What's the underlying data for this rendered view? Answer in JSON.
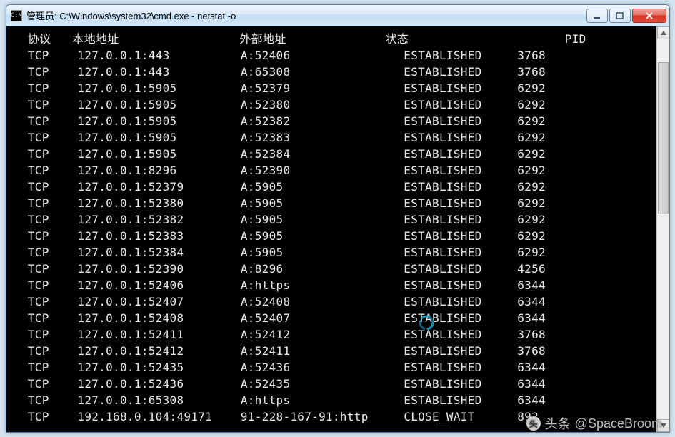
{
  "window": {
    "icon_text": "C:\\",
    "title": "管理员: C:\\Windows\\system32\\cmd.exe - netstat  -o"
  },
  "headers": {
    "proto": "协议",
    "local": "本地地址",
    "foreign": "外部地址",
    "state": "状态",
    "pid": "PID"
  },
  "rows": [
    {
      "proto": "TCP",
      "local": "127.0.0.1:443",
      "foreign": "A:52406",
      "state": "ESTABLISHED",
      "pid": "3768"
    },
    {
      "proto": "TCP",
      "local": "127.0.0.1:443",
      "foreign": "A:65308",
      "state": "ESTABLISHED",
      "pid": "3768"
    },
    {
      "proto": "TCP",
      "local": "127.0.0.1:5905",
      "foreign": "A:52379",
      "state": "ESTABLISHED",
      "pid": "6292"
    },
    {
      "proto": "TCP",
      "local": "127.0.0.1:5905",
      "foreign": "A:52380",
      "state": "ESTABLISHED",
      "pid": "6292"
    },
    {
      "proto": "TCP",
      "local": "127.0.0.1:5905",
      "foreign": "A:52382",
      "state": "ESTABLISHED",
      "pid": "6292"
    },
    {
      "proto": "TCP",
      "local": "127.0.0.1:5905",
      "foreign": "A:52383",
      "state": "ESTABLISHED",
      "pid": "6292"
    },
    {
      "proto": "TCP",
      "local": "127.0.0.1:5905",
      "foreign": "A:52384",
      "state": "ESTABLISHED",
      "pid": "6292"
    },
    {
      "proto": "TCP",
      "local": "127.0.0.1:8296",
      "foreign": "A:52390",
      "state": "ESTABLISHED",
      "pid": "6292"
    },
    {
      "proto": "TCP",
      "local": "127.0.0.1:52379",
      "foreign": "A:5905",
      "state": "ESTABLISHED",
      "pid": "6292"
    },
    {
      "proto": "TCP",
      "local": "127.0.0.1:52380",
      "foreign": "A:5905",
      "state": "ESTABLISHED",
      "pid": "6292"
    },
    {
      "proto": "TCP",
      "local": "127.0.0.1:52382",
      "foreign": "A:5905",
      "state": "ESTABLISHED",
      "pid": "6292"
    },
    {
      "proto": "TCP",
      "local": "127.0.0.1:52383",
      "foreign": "A:5905",
      "state": "ESTABLISHED",
      "pid": "6292"
    },
    {
      "proto": "TCP",
      "local": "127.0.0.1:52384",
      "foreign": "A:5905",
      "state": "ESTABLISHED",
      "pid": "6292"
    },
    {
      "proto": "TCP",
      "local": "127.0.0.1:52390",
      "foreign": "A:8296",
      "state": "ESTABLISHED",
      "pid": "4256"
    },
    {
      "proto": "TCP",
      "local": "127.0.0.1:52406",
      "foreign": "A:https",
      "state": "ESTABLISHED",
      "pid": "6344"
    },
    {
      "proto": "TCP",
      "local": "127.0.0.1:52407",
      "foreign": "A:52408",
      "state": "ESTABLISHED",
      "pid": "6344"
    },
    {
      "proto": "TCP",
      "local": "127.0.0.1:52408",
      "foreign": "A:52407",
      "state": "ESTABLISHED",
      "pid": "6344"
    },
    {
      "proto": "TCP",
      "local": "127.0.0.1:52411",
      "foreign": "A:52412",
      "state": "ESTABLISHED",
      "pid": "3768"
    },
    {
      "proto": "TCP",
      "local": "127.0.0.1:52412",
      "foreign": "A:52411",
      "state": "ESTABLISHED",
      "pid": "3768"
    },
    {
      "proto": "TCP",
      "local": "127.0.0.1:52435",
      "foreign": "A:52436",
      "state": "ESTABLISHED",
      "pid": "6344"
    },
    {
      "proto": "TCP",
      "local": "127.0.0.1:52436",
      "foreign": "A:52435",
      "state": "ESTABLISHED",
      "pid": "6344"
    },
    {
      "proto": "TCP",
      "local": "127.0.0.1:65308",
      "foreign": "A:https",
      "state": "ESTABLISHED",
      "pid": "6344"
    },
    {
      "proto": "TCP",
      "local": "192.168.0.104:49171",
      "foreign": "91-228-167-91:http",
      "state": "CLOSE_WAIT",
      "pid": "892"
    }
  ],
  "columns": {
    "proto_w": 7,
    "local_w": 23,
    "foreign_w": 23,
    "state_w": 16
  },
  "watermark": {
    "prefix": "头条",
    "handle": "@SpaceBroom"
  }
}
